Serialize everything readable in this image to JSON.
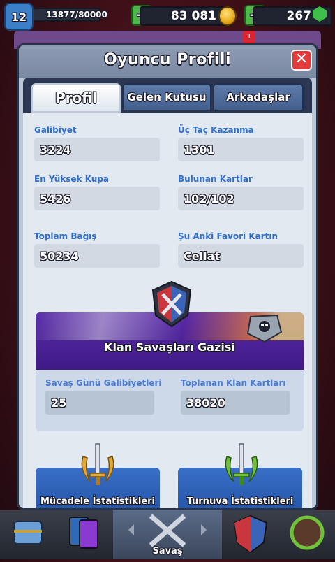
{
  "topbar": {
    "level": "12",
    "xp": "13877/80000",
    "gold": "83 081",
    "gems": "267",
    "plus_gold_label": "+",
    "plus_gems_label": "+"
  },
  "modal": {
    "title": "Oyuncu Profili",
    "close_label": "✕",
    "tabs": [
      {
        "label": "Profil"
      },
      {
        "label": "Gelen Kutusu"
      },
      {
        "label": "Arkadaşlar"
      }
    ]
  },
  "stats": [
    {
      "label": "Galibiyet",
      "value": "3224"
    },
    {
      "label": "Üç Taç Kazanma",
      "value": "1301"
    },
    {
      "label": "En Yüksek Kupa",
      "value": "5426"
    },
    {
      "label": "Bulunan Kartlar",
      "value": "102/102"
    },
    {
      "label": "Toplam Bağış",
      "value": "50234"
    },
    {
      "label": "Şu Anki Favori Kartın",
      "value": "Cellat"
    }
  ],
  "clan_war": {
    "title": "Klan Savaşları Gazisi",
    "stats": [
      {
        "label": "Savaş Günü Galibiyetleri",
        "value": "25"
      },
      {
        "label": "Toplanan Klan Kartları",
        "value": "38020"
      }
    ]
  },
  "more_stats": {
    "challenge": "Mücadele İstatistikleri",
    "tournament": "Turnuva İstatistikleri"
  },
  "bottomnav": {
    "battle_label": "Savaş"
  },
  "colors": {
    "label_blue": "#2f6fd1",
    "clan_purple": "#4a1f95",
    "stat_box": "#d2d9e2",
    "close_red": "#e23a3a"
  }
}
